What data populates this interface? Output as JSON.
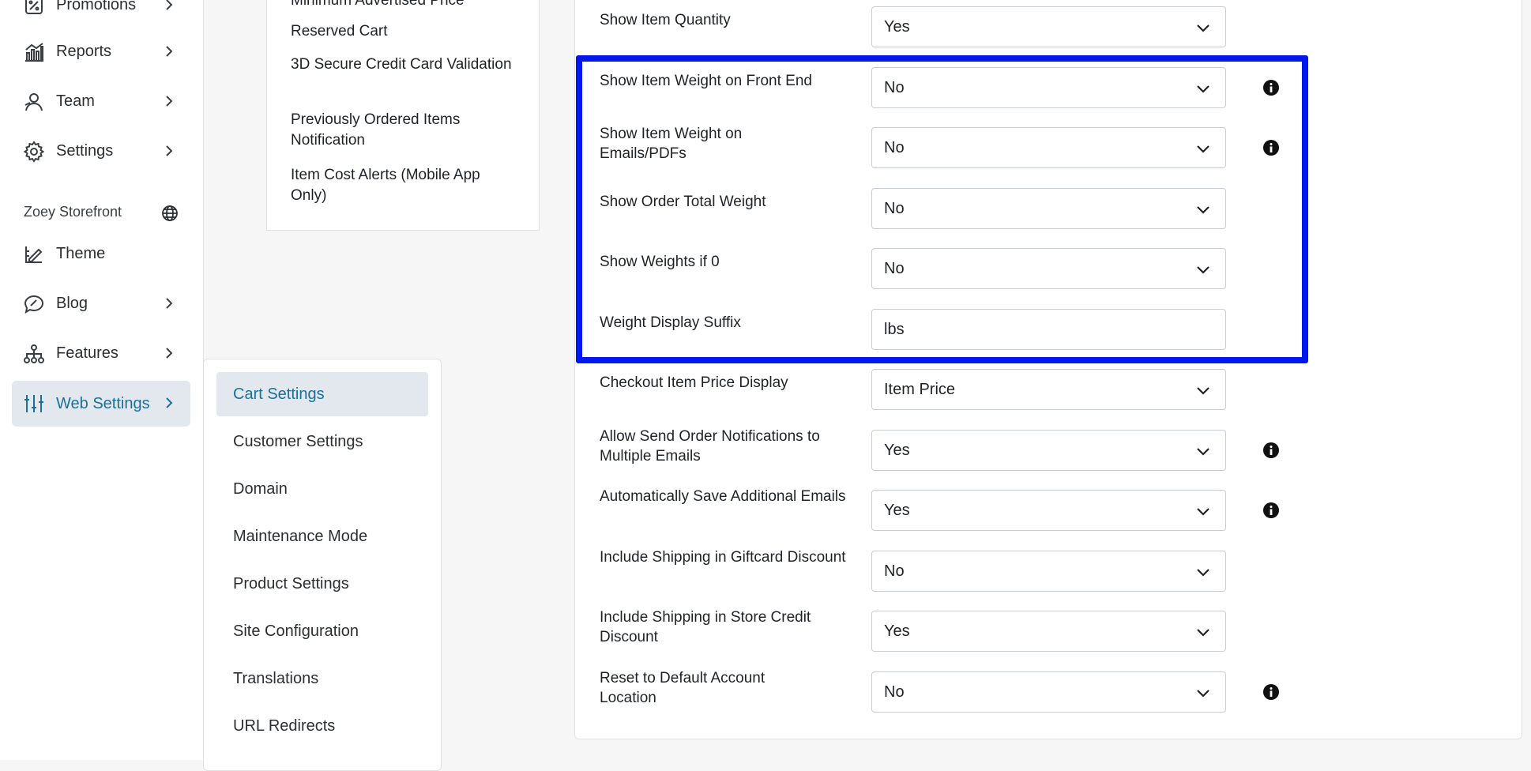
{
  "nav": {
    "items": [
      {
        "label": "Promotions",
        "icon": "promotions-icon"
      },
      {
        "label": "Reports",
        "icon": "reports-icon"
      },
      {
        "label": "Team",
        "icon": "team-icon"
      },
      {
        "label": "Settings",
        "icon": "gear-icon"
      },
      {
        "label": "Theme",
        "icon": "theme-icon"
      },
      {
        "label": "Blog",
        "icon": "blog-icon"
      },
      {
        "label": "Features",
        "icon": "features-icon"
      },
      {
        "label": "Web Settings",
        "icon": "sliders-icon"
      }
    ],
    "section_label": "Zoey Storefront",
    "active_color": "#1a6f9b"
  },
  "sub_list_top": {
    "items": [
      "Minimum Advertised Price",
      "Reserved Cart",
      "3D Secure Credit Card Validation",
      "Previously Ordered Items Notification",
      "Item Cost Alerts (Mobile App Only)"
    ]
  },
  "sub_menu": {
    "items": [
      "Cart Settings",
      "Customer Settings",
      "Domain",
      "Maintenance Mode",
      "Product Settings",
      "Site Configuration",
      "Translations",
      "URL Redirects"
    ],
    "active": "Cart Settings"
  },
  "settings": {
    "rows": [
      {
        "label": "Show Item Quantity",
        "value": "Yes",
        "type": "select",
        "info": false
      },
      {
        "label": "Show Item Weight on Front End",
        "value": "No",
        "type": "select",
        "info": true
      },
      {
        "label": "Show Item Weight on Emails/PDFs",
        "value": "No",
        "type": "select",
        "info": true
      },
      {
        "label": "Show Order Total Weight",
        "value": "No",
        "type": "select",
        "info": false
      },
      {
        "label": "Show Weights if 0",
        "value": "No",
        "type": "select",
        "info": false
      },
      {
        "label": "Weight Display Suffix",
        "value": "lbs",
        "type": "text",
        "info": false
      },
      {
        "label": "Checkout Item Price Display",
        "value": "Item Price",
        "type": "select",
        "info": false
      },
      {
        "label": "Allow Send Order Notifications to Multiple Emails",
        "value": "Yes",
        "type": "select",
        "info": true
      },
      {
        "label": "Automatically Save Additional Emails",
        "value": "Yes",
        "type": "select",
        "info": true
      },
      {
        "label": "Include Shipping in Giftcard Discount",
        "value": "No",
        "type": "select",
        "info": false
      },
      {
        "label": "Include Shipping in Store Credit Discount",
        "value": "Yes",
        "type": "select",
        "info": false
      },
      {
        "label": "Reset to Default Account Location",
        "value": "No",
        "type": "select",
        "info": true
      }
    ],
    "highlight_color": "#0018ee"
  }
}
